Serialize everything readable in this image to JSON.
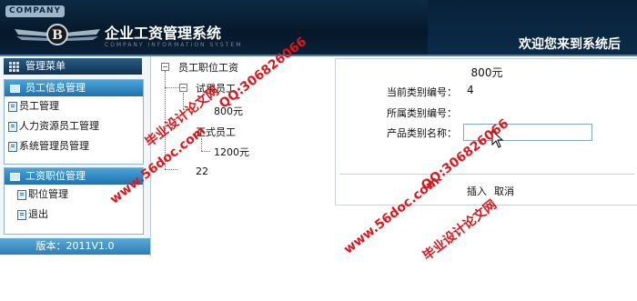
{
  "header": {
    "company": "COMPANY",
    "system_title": "企业工资管理系统",
    "system_title_en": "COMPANY INFORMATION SYSTEM",
    "welcome": "欢迎您来到系统后"
  },
  "sidebar": {
    "menu_title": "管理菜单",
    "sections": [
      {
        "title": "员工信息管理",
        "items": [
          "员工管理",
          "人力资源员工管理",
          "系统管理员管理"
        ]
      },
      {
        "title": "工资职位管理",
        "items": [
          "职位管理",
          "退出"
        ]
      }
    ],
    "version": "版本：2011V1.0"
  },
  "tree": {
    "root": "员工职位工资",
    "children": [
      {
        "label": "试用员工",
        "children": [
          "800元"
        ]
      },
      {
        "label": "正式员工",
        "children": [
          "1200元"
        ]
      },
      {
        "label": "22"
      }
    ]
  },
  "form": {
    "title": "800元",
    "current_category_label": "当前类别编号：",
    "current_category_value": "4",
    "parent_category_label": "所属类别编号：",
    "parent_category_value": "",
    "product_name_label": "产品类别名称：",
    "product_name_value": "",
    "insert_button": "插入",
    "cancel_button": "取消"
  },
  "watermarks": [
    "毕业设计论文网",
    "QQ:306826066",
    "www.56doc.com",
    "www.56doc.com",
    "QQ:306826066",
    "毕业设计论文网"
  ]
}
